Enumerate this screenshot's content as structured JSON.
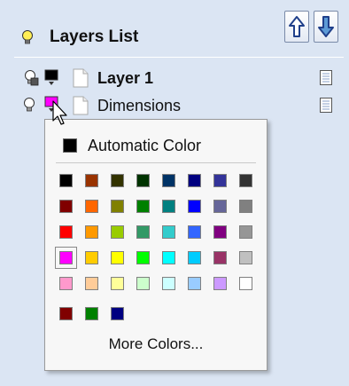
{
  "panel": {
    "title": "Layers List",
    "up_button_icon": "arrow-up-icon",
    "down_button_icon": "arrow-down-icon"
  },
  "layers": [
    {
      "name": "Layer 1",
      "bold": true,
      "color": "#000000"
    },
    {
      "name": "Dimensions",
      "bold": false,
      "color": "#ff00ff"
    }
  ],
  "color_popup": {
    "automatic_label": "Automatic Color",
    "automatic_color": "#000000",
    "selected_color": "#ff00ff",
    "palette_rows": [
      [
        "#000000",
        "#993300",
        "#333300",
        "#003300",
        "#003366",
        "#000080",
        "#333399",
        "#333333"
      ],
      [
        "#800000",
        "#ff6600",
        "#808000",
        "#008000",
        "#008080",
        "#0000ff",
        "#666699",
        "#808080"
      ],
      [
        "#ff0000",
        "#ff9900",
        "#99cc00",
        "#339966",
        "#33cccc",
        "#3366ff",
        "#800080",
        "#969696"
      ],
      [
        "#ff00ff",
        "#ffcc00",
        "#ffff00",
        "#00ff00",
        "#00ffff",
        "#00ccff",
        "#993366",
        "#c0c0c0"
      ],
      [
        "#ff99cc",
        "#ffcc99",
        "#ffff99",
        "#ccffcc",
        "#ccffff",
        "#99ccff",
        "#cc99ff",
        "#ffffff"
      ]
    ],
    "recent_colors": [
      "#800000",
      "#008000",
      "#000080"
    ],
    "more_colors_label": "More Colors..."
  }
}
